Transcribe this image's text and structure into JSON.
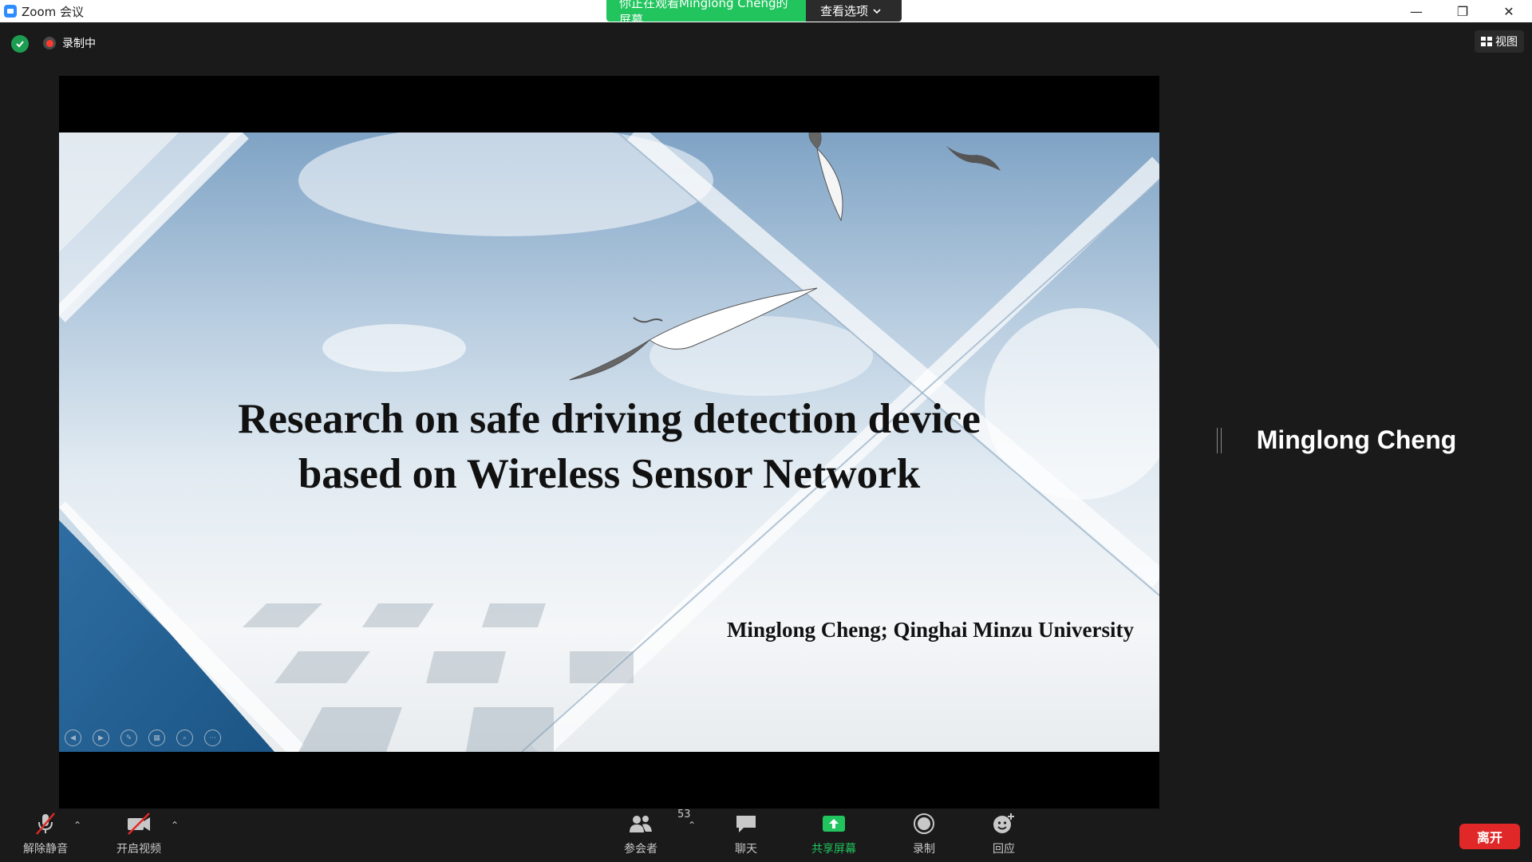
{
  "window": {
    "title": "Zoom 会议",
    "minimize": "—",
    "restore": "❐",
    "close": "✕"
  },
  "banner": {
    "viewing_text": "你正在观看Minglong  Cheng的屏幕",
    "view_options": "查看选项"
  },
  "status": {
    "recording_label": "录制中"
  },
  "view": {
    "label": "视图"
  },
  "slide": {
    "title_line1": "Research on safe driving detection device",
    "title_line2": "based on Wireless Sensor Network",
    "author": "Minglong Cheng; Qinghai Minzu University"
  },
  "speaker": {
    "name": "Minglong Cheng"
  },
  "toolbar": {
    "unmute_label": "解除静音",
    "start_video_label": "开启视频",
    "participants_label": "参会者",
    "participants_count": "53",
    "chat_label": "聊天",
    "share_label": "共享屏幕",
    "record_label": "录制",
    "reactions_label": "回应",
    "leave_label": "离开"
  },
  "colors": {
    "share_green": "#21c45d",
    "leave_red": "#e02828",
    "mute_slash_red": "#e02828"
  }
}
